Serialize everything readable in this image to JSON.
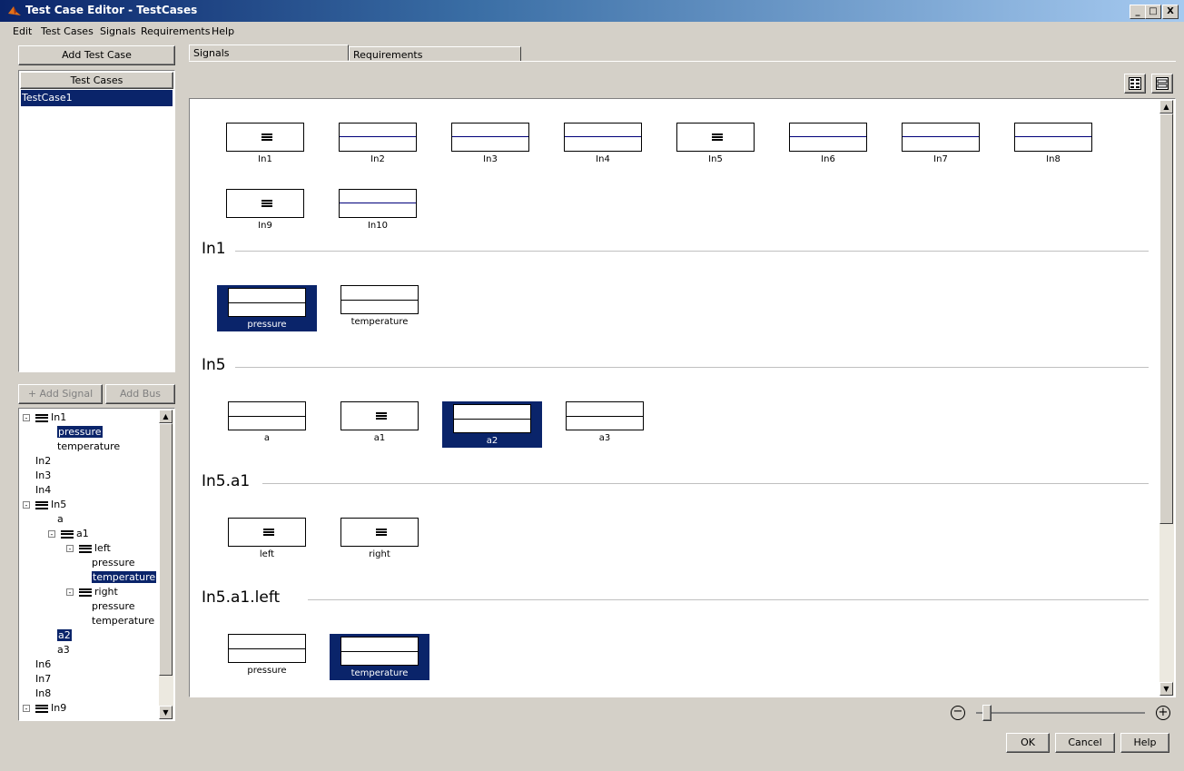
{
  "window": {
    "title": "Test Case Editor - TestCases",
    "min": "_",
    "max": "□",
    "close": "X"
  },
  "menu": [
    "Edit",
    "Test Cases",
    "Signals",
    "Requirements",
    "Help"
  ],
  "left": {
    "add_test_case": "Add Test Case",
    "test_cases_header": "Test Cases",
    "test_cases": [
      "TestCase1"
    ],
    "add_signal": "+ Add Signal",
    "add_bus": "Add Bus"
  },
  "tree": [
    {
      "label": "In1",
      "bus": true,
      "depth": 0,
      "expand": "-"
    },
    {
      "label": "pressure",
      "depth": 1,
      "selected": true
    },
    {
      "label": "temperature",
      "depth": 1
    },
    {
      "label": "In2",
      "depth": 0
    },
    {
      "label": "In3",
      "depth": 0
    },
    {
      "label": "In4",
      "depth": 0
    },
    {
      "label": "In5",
      "bus": true,
      "depth": 0,
      "expand": "-"
    },
    {
      "label": "a",
      "depth": 1
    },
    {
      "label": "a1",
      "bus": true,
      "depth": 1,
      "expand": "-"
    },
    {
      "label": "left",
      "bus": true,
      "depth": 2,
      "expand": "-"
    },
    {
      "label": "pressure",
      "depth": 3
    },
    {
      "label": "temperature",
      "depth": 3,
      "selected": true
    },
    {
      "label": "right",
      "bus": true,
      "depth": 2,
      "expand": "-"
    },
    {
      "label": "pressure",
      "depth": 3
    },
    {
      "label": "temperature",
      "depth": 3
    },
    {
      "label": "a2",
      "depth": 1,
      "selected": true
    },
    {
      "label": "a3",
      "depth": 1
    },
    {
      "label": "In6",
      "depth": 0
    },
    {
      "label": "In7",
      "depth": 0
    },
    {
      "label": "In8",
      "depth": 0
    },
    {
      "label": "In9",
      "bus": true,
      "depth": 0,
      "expand": "-"
    }
  ],
  "tabs": {
    "signals": "Signals",
    "requirements": "Requirements"
  },
  "top_signals": [
    {
      "name": "In1",
      "bus": true
    },
    {
      "name": "In2"
    },
    {
      "name": "In3"
    },
    {
      "name": "In4"
    },
    {
      "name": "In5",
      "bus": true
    },
    {
      "name": "In6"
    },
    {
      "name": "In7"
    },
    {
      "name": "In8"
    },
    {
      "name": "In9",
      "bus": true
    },
    {
      "name": "In10"
    }
  ],
  "sections": [
    {
      "title": "In1",
      "items": [
        {
          "name": "pressure",
          "selected": true,
          "split": true
        },
        {
          "name": "temperature",
          "split": true
        }
      ]
    },
    {
      "title": "In5",
      "items": [
        {
          "name": "a",
          "split": true
        },
        {
          "name": "a1",
          "bus": true
        },
        {
          "name": "a2",
          "selected": true,
          "split": true
        },
        {
          "name": "a3",
          "split": true
        }
      ]
    },
    {
      "title": "In5.a1",
      "items": [
        {
          "name": "left",
          "bus": true
        },
        {
          "name": "right",
          "bus": true
        }
      ]
    },
    {
      "title": "In5.a1.left",
      "items": [
        {
          "name": "pressure",
          "split": true
        },
        {
          "name": "temperature",
          "selected": true,
          "split": true
        }
      ]
    }
  ],
  "zoom": {
    "minus": "−",
    "plus": "+",
    "level": 0.04
  },
  "buttons": {
    "ok": "OK",
    "cancel": "Cancel",
    "help": "Help"
  }
}
